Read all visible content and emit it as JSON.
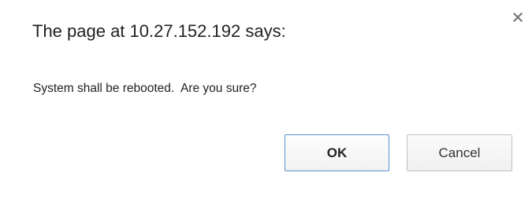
{
  "dialog": {
    "title": "The page at 10.27.152.192 says:",
    "message": "System shall be rebooted.  Are you sure?",
    "close_icon": "close-icon",
    "ok_label": "OK",
    "cancel_label": "Cancel"
  }
}
